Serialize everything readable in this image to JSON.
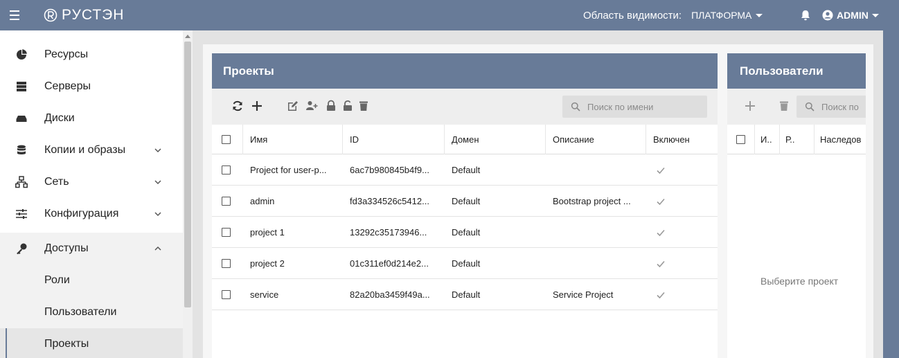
{
  "header": {
    "logo_text": "РУСТЭН",
    "scope_label": "Область видимости:",
    "scope_value": "ПЛАТФОРМА",
    "user_label": "ADMIN"
  },
  "sidebar": {
    "items": [
      {
        "label": "Ресурсы",
        "icon": "pie-chart-icon"
      },
      {
        "label": "Серверы",
        "icon": "server-icon"
      },
      {
        "label": "Диски",
        "icon": "disk-icon"
      },
      {
        "label": "Копии и образы",
        "icon": "database-icon",
        "expand": "collapsed"
      },
      {
        "label": "Сеть",
        "icon": "network-icon",
        "expand": "collapsed"
      },
      {
        "label": "Конфигурация",
        "icon": "sliders-icon",
        "expand": "collapsed"
      },
      {
        "label": "Доступы",
        "icon": "key-icon",
        "expand": "expanded"
      },
      {
        "label": "Роли",
        "sub": true
      },
      {
        "label": "Пользователи",
        "sub": true
      },
      {
        "label": "Проекты",
        "sub": true,
        "active": true
      }
    ]
  },
  "projects": {
    "title": "Проекты",
    "search_placeholder": "Поиск по имени",
    "columns": [
      "Имя",
      "ID",
      "Домен",
      "Описание",
      "Включен"
    ],
    "rows": [
      {
        "name": "Project for user-p...",
        "id": "6ac7b980845b4f9...",
        "domain": "Default",
        "description": "",
        "enabled": true
      },
      {
        "name": "admin",
        "id": "fd3a334526c5412...",
        "domain": "Default",
        "description": "Bootstrap project ...",
        "enabled": true
      },
      {
        "name": "project 1",
        "id": "13292c35173946...",
        "domain": "Default",
        "description": "",
        "enabled": true
      },
      {
        "name": "project 2",
        "id": "01c311ef0d214e2...",
        "domain": "Default",
        "description": "",
        "enabled": true
      },
      {
        "name": "service",
        "id": "82a20ba3459f49a...",
        "domain": "Default",
        "description": "Service Project",
        "enabled": true
      }
    ]
  },
  "users": {
    "title": "Пользователи",
    "search_placeholder": "Поиск по",
    "columns": [
      "И..",
      "Р..",
      "Наследов"
    ],
    "empty_text": "Выберите проект"
  },
  "colors": {
    "accent": "#687b98",
    "check": "#999999"
  }
}
